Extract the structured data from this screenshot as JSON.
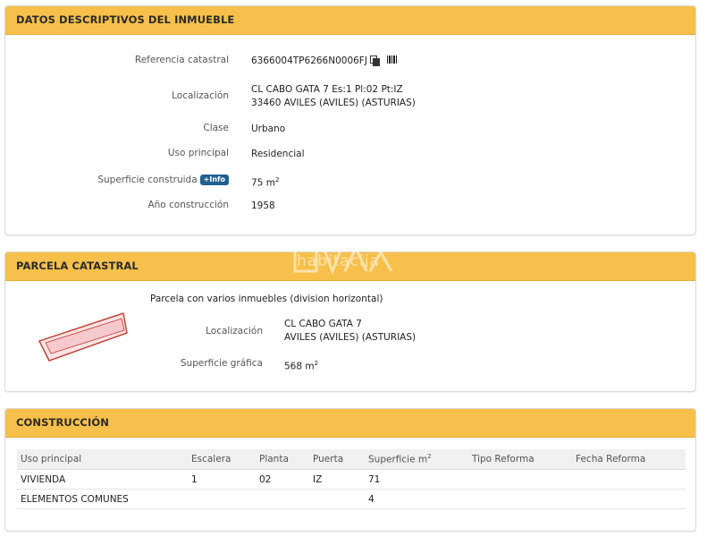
{
  "datos": {
    "title": "DATOS DESCRIPTIVOS DEL INMUEBLE",
    "referencia_label": "Referencia catastral",
    "referencia_value": "6366004TP6266N0006FJ",
    "localizacion_label": "Localización",
    "localizacion_line1": "CL CABO GATA 7 Es:1 Pl:02 Pt:IZ",
    "localizacion_line2": "33460 AVILES (AVILES) (ASTURIAS)",
    "clase_label": "Clase",
    "clase_value": "Urbano",
    "uso_label": "Uso principal",
    "uso_value": "Residencial",
    "superficie_label": "Superficie construida",
    "info_badge": "+Info",
    "superficie_value": "75 m",
    "superficie_unit_sup": "2",
    "anio_label": "Año construcción",
    "anio_value": "1958"
  },
  "parcela": {
    "title": "PARCELA CATASTRAL",
    "description": "Parcela con varios inmuebles (division horizontal)",
    "localizacion_label": "Localización",
    "localizacion_line1": "CL CABO GATA 7",
    "localizacion_line2": "AVILES (AVILES) (ASTURIAS)",
    "superficie_label": "Superficie gráfica",
    "superficie_value": "568 m",
    "superficie_unit_sup": "2"
  },
  "construccion": {
    "title": "CONSTRUCCIÓN",
    "headers": [
      "Uso principal",
      "Escalera",
      "Planta",
      "Puerta",
      "Superficie m",
      "Tipo Reforma",
      "Fecha Reforma"
    ],
    "superficie_header_sup": "2",
    "rows": [
      [
        "VIVIENDA",
        "1",
        "02",
        "IZ",
        "71",
        "",
        ""
      ],
      [
        "ELEMENTOS COMUNES",
        "",
        "",
        "",
        "4",
        "",
        ""
      ]
    ]
  },
  "watermark": {
    "logo_text": "VA",
    "sub_text": "habitacija"
  },
  "colors": {
    "header_bg": "#f7c04a",
    "badge_bg": "#21608f",
    "parcel_fill": "#f6c9cc",
    "parcel_stroke": "#c0392b"
  }
}
